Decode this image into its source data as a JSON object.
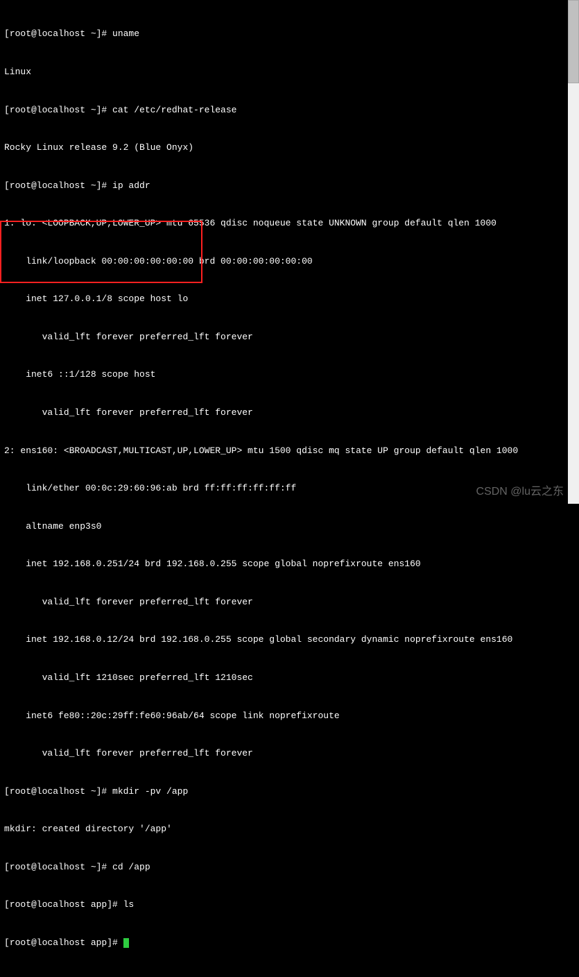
{
  "terminal": {
    "lines": [
      "[root@localhost ~]# uname",
      "Linux",
      "[root@localhost ~]# cat /etc/redhat-release",
      "Rocky Linux release 9.2 (Blue Onyx)",
      "[root@localhost ~]# ip addr",
      "1: lo: <LOOPBACK,UP,LOWER_UP> mtu 65536 qdisc noqueue state UNKNOWN group default qlen 1000",
      "    link/loopback 00:00:00:00:00:00 brd 00:00:00:00:00:00",
      "    inet 127.0.0.1/8 scope host lo",
      "       valid_lft forever preferred_lft forever",
      "    inet6 ::1/128 scope host",
      "       valid_lft forever preferred_lft forever",
      "2: ens160: <BROADCAST,MULTICAST,UP,LOWER_UP> mtu 1500 qdisc mq state UP group default qlen 1000",
      "    link/ether 00:0c:29:60:96:ab brd ff:ff:ff:ff:ff:ff",
      "    altname enp3s0",
      "    inet 192.168.0.251/24 brd 192.168.0.255 scope global noprefixroute ens160",
      "       valid_lft forever preferred_lft forever",
      "    inet 192.168.0.12/24 brd 192.168.0.255 scope global secondary dynamic noprefixroute ens160",
      "       valid_lft 1210sec preferred_lft 1210sec",
      "    inet6 fe80::20c:29ff:fe60:96ab/64 scope link noprefixroute",
      "       valid_lft forever preferred_lft forever",
      "[root@localhost ~]# mkdir -pv /app",
      "mkdir: created directory '/app'",
      "[root@localhost ~]# cd /app",
      "[root@localhost app]# ls",
      "[root@localhost app]# "
    ]
  },
  "watermark": "CSDN @lu云之东"
}
